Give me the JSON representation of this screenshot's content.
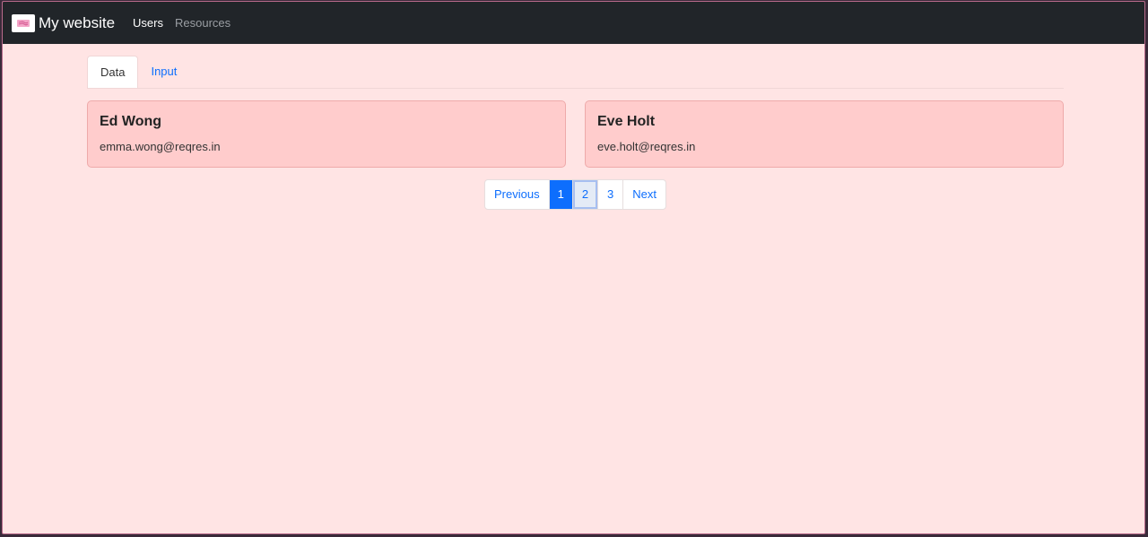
{
  "navbar": {
    "brand": "My website",
    "links": [
      {
        "label": "Users",
        "active": true
      },
      {
        "label": "Resources",
        "active": false
      }
    ]
  },
  "tabs": [
    {
      "label": "Data",
      "active": true
    },
    {
      "label": "Input",
      "active": false
    }
  ],
  "users": [
    {
      "name": "Ed Wong",
      "email": "emma.wong@reqres.in"
    },
    {
      "name": "Eve Holt",
      "email": "eve.holt@reqres.in"
    }
  ],
  "pagination": {
    "previous": "Previous",
    "pages": [
      "1",
      "2",
      "3"
    ],
    "current": "1",
    "focused": "2",
    "next": "Next"
  },
  "colors": {
    "navbar_bg": "#212529",
    "page_bg": "#ffe4e4",
    "card_bg": "#ffcccc",
    "accent": "#0d6efd"
  }
}
